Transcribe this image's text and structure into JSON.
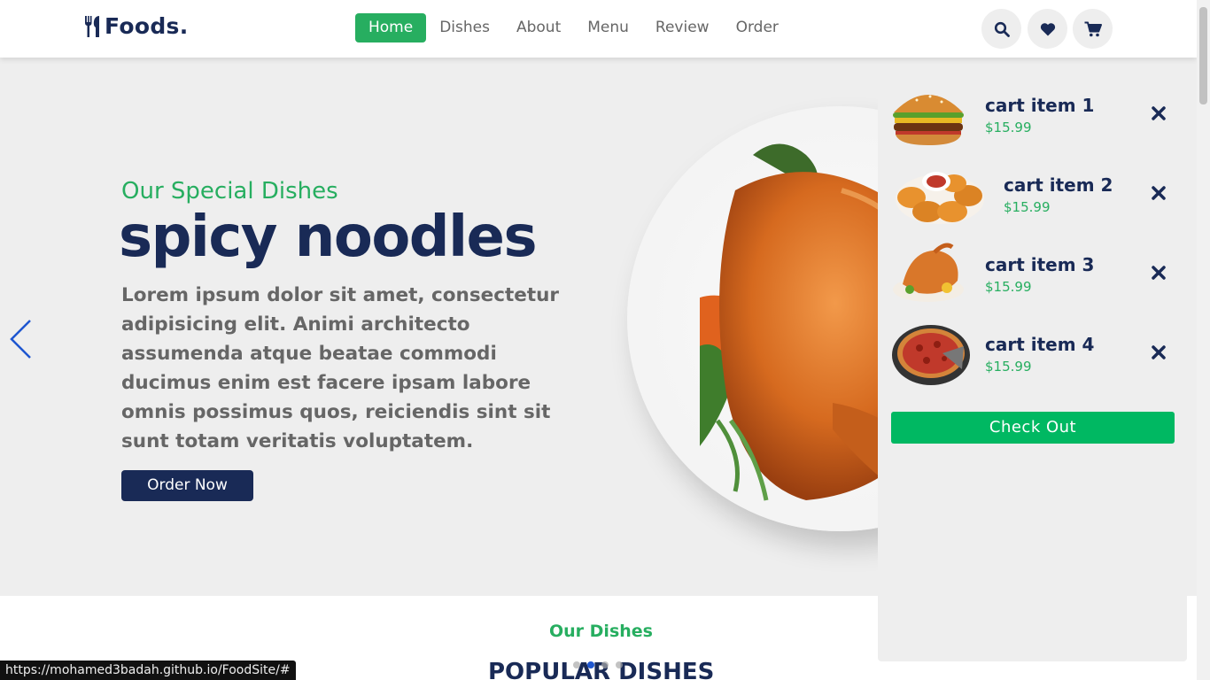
{
  "header": {
    "logo_text": "Foods.",
    "logo_icon": "utensils-icon",
    "nav": [
      {
        "label": "Home",
        "active": true
      },
      {
        "label": "Dishes",
        "active": false
      },
      {
        "label": "About",
        "active": false
      },
      {
        "label": "Menu",
        "active": false
      },
      {
        "label": "Review",
        "active": false
      },
      {
        "label": "Order",
        "active": false
      }
    ],
    "icons": [
      "search-icon",
      "heart-icon",
      "cart-icon"
    ]
  },
  "hero": {
    "subtitle": "Our Special Dishes",
    "title": "spicy noodles",
    "description": "Lorem ipsum dolor sit amet, consectetur adipisicing elit. Animi architecto assumenda atque beatae commodi ducimus enim est facere ipsam labore omnis possimus quos, reiciendis sint sit sunt totam veritatis voluptatem.",
    "button_label": "Order Now",
    "prev_icon": "chevron-left-icon"
  },
  "slider": {
    "slides": 4,
    "active_index": 1
  },
  "section": {
    "subtitle": "Our Dishes",
    "title": "POPULAR DISHES"
  },
  "cart": {
    "items": [
      {
        "name": "cart item 1",
        "price": "$15.99",
        "image": "burger"
      },
      {
        "name": "cart item 2",
        "price": "$15.99",
        "image": "nuggets"
      },
      {
        "name": "cart item 3",
        "price": "$15.99",
        "image": "roast-chicken"
      },
      {
        "name": "cart item 4",
        "price": "$15.99",
        "image": "pizza"
      }
    ],
    "checkout_label": "Check Out"
  },
  "status_url": "https://mohamed3badah.github.io/FoodSite/#",
  "colors": {
    "primary_green": "#27ae60",
    "navy": "#192a56",
    "checkout_green": "#00b862",
    "hero_bg": "#eeeeee"
  }
}
